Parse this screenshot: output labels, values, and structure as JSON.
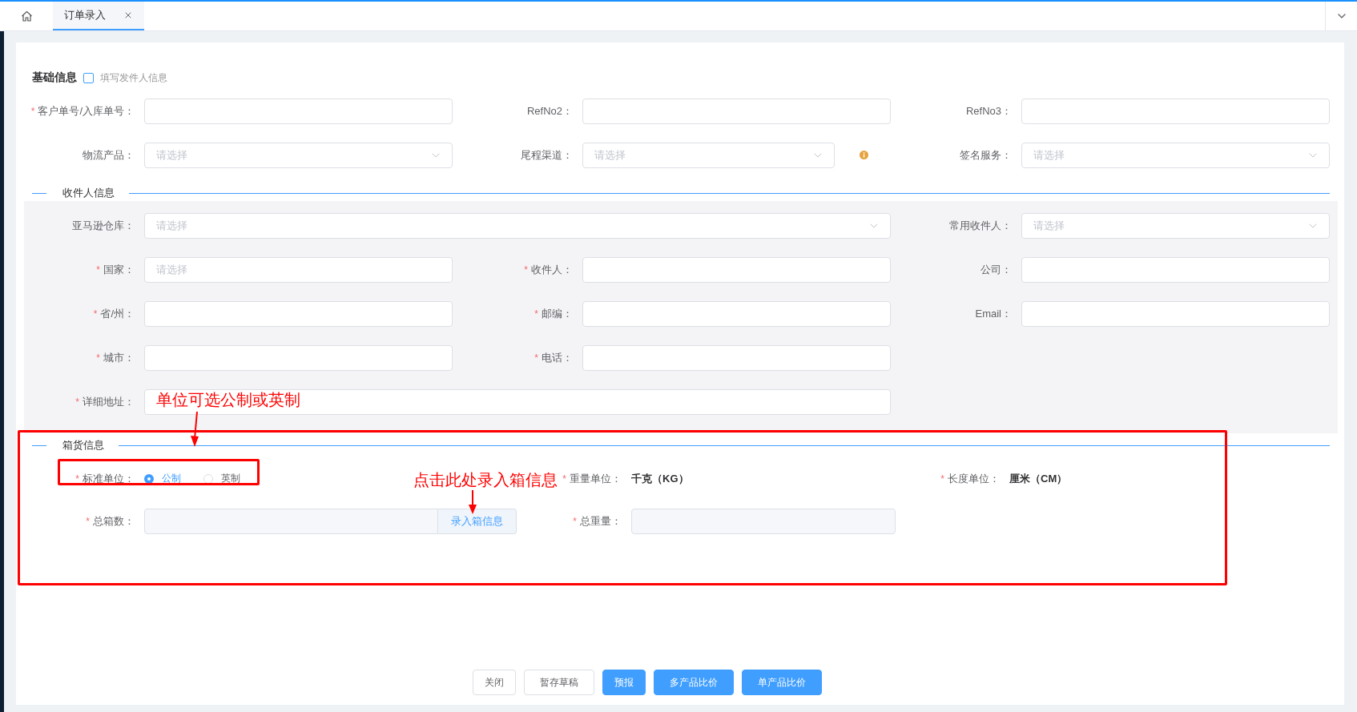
{
  "tabs": [
    {
      "label": "订单录入",
      "selected": true
    }
  ],
  "basic": {
    "title": "基础信息",
    "sender_checkbox": {
      "label": "填写发件人信息",
      "checked": false
    },
    "fields": [
      {
        "mark": "*",
        "label": "客户单号/入库单号：",
        "kind": "input"
      },
      {
        "label": "RefNo2：",
        "kind": "input"
      },
      {
        "label": "RefNo3：",
        "kind": "input"
      },
      {
        "label": "物流产品：",
        "kind": "select",
        "placeholder": "请选择"
      },
      {
        "label": "尾程渠道：",
        "kind": "select",
        "placeholder": "请选择",
        "info": true
      },
      {
        "label": "签名服务：",
        "kind": "select",
        "placeholder": "请选择"
      }
    ]
  },
  "receiver": {
    "title": "收件人信息",
    "fields": [
      {
        "label": "亚马逊仓库：",
        "kind": "select",
        "placeholder": "请选择",
        "wide": true
      },
      {
        "label": "常用收件人：",
        "kind": "select",
        "placeholder": "请选择"
      },
      {
        "mark": "*",
        "label": "国家：",
        "kind": "input",
        "placeholder": "请选择"
      },
      {
        "mark": "*",
        "label": "收件人：",
        "kind": "input"
      },
      {
        "label": "公司：",
        "kind": "input"
      },
      {
        "mark": "*",
        "label": "省/州：",
        "kind": "input"
      },
      {
        "mark": "*",
        "label": "邮编：",
        "kind": "input"
      },
      {
        "label": "Email：",
        "kind": "input"
      },
      {
        "mark": "*",
        "label": "城市：",
        "kind": "input"
      },
      {
        "mark": "*",
        "label": "电话：",
        "kind": "input"
      },
      {
        "mark": "*",
        "label": "详细地址：",
        "kind": "input",
        "wide": true
      }
    ]
  },
  "cargo": {
    "title": "箱货信息",
    "fields": [
      {
        "mark": "*",
        "label": "标准单位：",
        "kind": "radio",
        "options": [
          {
            "label": "公制",
            "selected": true
          },
          {
            "label": "英制",
            "selected": false
          }
        ]
      },
      {
        "mark": "*",
        "label": "重量单位：",
        "kind": "value",
        "value": "千克（KG）"
      },
      {
        "mark": "*",
        "label": "长度单位：",
        "kind": "value",
        "value": "厘米（CM）"
      },
      {
        "mark": "*",
        "label": "总箱数：",
        "kind": "input_button",
        "disabled": true,
        "button": "录入箱信息"
      },
      {
        "mark": "*",
        "label": "总重量：",
        "kind": "input",
        "disabled": true
      }
    ]
  },
  "buttons": [
    {
      "label": "关闭",
      "kind": "default"
    },
    {
      "label": "暂存草稿",
      "kind": "default"
    },
    {
      "label": "预报",
      "kind": "primary"
    },
    {
      "label": "多产品比价",
      "kind": "primary"
    },
    {
      "label": "单产品比价",
      "kind": "primary"
    }
  ],
  "annotations": [
    {
      "text": "单位可选公制或英制"
    },
    {
      "text": "点击此处录入箱信息"
    }
  ]
}
